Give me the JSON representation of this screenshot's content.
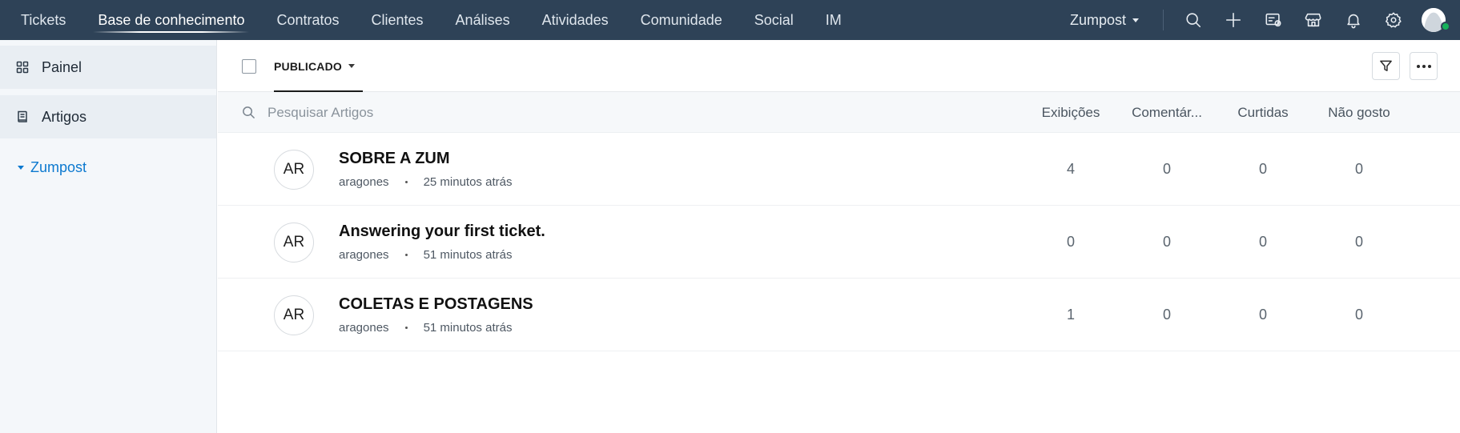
{
  "nav": {
    "tabs": [
      {
        "label": "Tickets",
        "active": false
      },
      {
        "label": "Base de conhecimento",
        "active": true
      },
      {
        "label": "Contratos",
        "active": false
      },
      {
        "label": "Clientes",
        "active": false
      },
      {
        "label": "Análises",
        "active": false
      },
      {
        "label": "Atividades",
        "active": false
      },
      {
        "label": "Comunidade",
        "active": false
      },
      {
        "label": "Social",
        "active": false
      },
      {
        "label": "IM",
        "active": false
      }
    ],
    "org_name": "Zumpost",
    "icons": [
      "search-icon",
      "plus-icon",
      "contact-card-icon",
      "store-icon",
      "bell-icon",
      "gear-icon"
    ],
    "colors": {
      "bar": "#2e4257",
      "status_online": "#16b25b"
    }
  },
  "sidebar": {
    "items": [
      {
        "label": "Painel",
        "icon": "dashboard-grid-icon"
      },
      {
        "label": "Artigos",
        "icon": "article-icon"
      }
    ],
    "folder": "Zumpost",
    "colors": {
      "folder_link": "#0c79cf"
    }
  },
  "toolbar": {
    "status_filter": "PUBLICADO"
  },
  "list": {
    "search_placeholder": "Pesquisar Artigos",
    "columns": [
      "Exibições",
      "Comentár...",
      "Curtidas",
      "Não gosto"
    ],
    "rows": [
      {
        "avatar": "AR",
        "title": "SOBRE A ZUM",
        "author": "aragones",
        "time": "25 minutos atrás",
        "views": "4",
        "comments": "0",
        "likes": "0",
        "dislikes": "0"
      },
      {
        "avatar": "AR",
        "title": "Answering your first ticket.",
        "author": "aragones",
        "time": "51 minutos atrás",
        "views": "0",
        "comments": "0",
        "likes": "0",
        "dislikes": "0"
      },
      {
        "avatar": "AR",
        "title": "COLETAS E POSTAGENS",
        "author": "aragones",
        "time": "51 minutos atrás",
        "views": "1",
        "comments": "0",
        "likes": "0",
        "dislikes": "0"
      }
    ]
  }
}
